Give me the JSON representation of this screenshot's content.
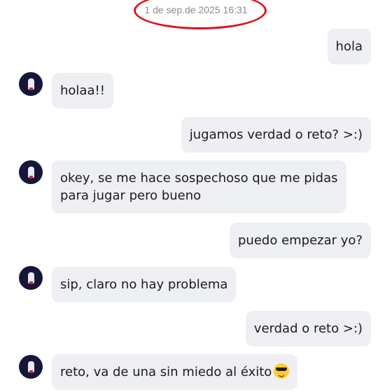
{
  "chat": {
    "timestamp": "1 de sep.de 2025 16:31",
    "messages": [
      {
        "from": "me",
        "text": "hola"
      },
      {
        "from": "them",
        "text": "holaa!!"
      },
      {
        "from": "me",
        "text": "jugamos verdad o reto? >:)"
      },
      {
        "from": "them",
        "lines": [
          "okey, se me hace sospechoso que me pidas",
          "para jugar pero bueno"
        ]
      },
      {
        "from": "me",
        "text": "puedo empezar yo?"
      },
      {
        "from": "them",
        "text": "sip, claro no hay problema"
      },
      {
        "from": "me",
        "text": "verdad o reto >:)"
      },
      {
        "from": "them",
        "text": "reto, va de una sin miedo al éxito",
        "emoji": "sunglasses-emoji"
      }
    ]
  },
  "colors": {
    "bubble": "#eeeff2",
    "annotation": "#e0121b",
    "avatar": "#15173a"
  }
}
